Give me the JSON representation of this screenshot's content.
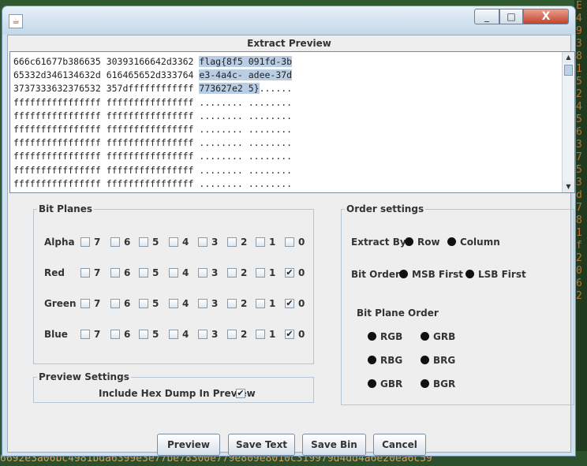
{
  "background": {
    "side_chars": [
      "E",
      "4",
      "9",
      "3",
      "8",
      "1",
      "5",
      "2",
      "4",
      "5",
      "6",
      "3",
      "7",
      "5",
      "3",
      "d",
      "7",
      "8",
      "1",
      "f",
      "2",
      "0",
      "6",
      "2"
    ],
    "bottom_text": "6692e3a06bc4981bda6399e3e77be78300e779e809e8010c319979d4dd4a6e20ea6c59"
  },
  "window": {
    "close_glyph": "X",
    "minimize_glyph": "_",
    "maximize_glyph": "□"
  },
  "preview": {
    "title": "Extract Preview",
    "lines": [
      {
        "hex": "666c61677b386635 30393166642d3362 ",
        "ascii_hl": "flag{8f5 091fd-3b",
        "ascii_rest": ""
      },
      {
        "hex": "65332d346134632d 616465652d333764 ",
        "ascii_hl": "e3-4a4c- adee-37d",
        "ascii_rest": ""
      },
      {
        "hex": "3737333632376532 357dffffffffffff ",
        "ascii_hl": "773627e2 5}",
        "ascii_rest": "......"
      },
      {
        "hex": "ffffffffffffffff ffffffffffffffff ",
        "ascii_hl": "",
        "ascii_rest": "........ ........"
      },
      {
        "hex": "ffffffffffffffff ffffffffffffffff ",
        "ascii_hl": "",
        "ascii_rest": "........ ........"
      },
      {
        "hex": "ffffffffffffffff ffffffffffffffff ",
        "ascii_hl": "",
        "ascii_rest": "........ ........"
      },
      {
        "hex": "ffffffffffffffff ffffffffffffffff ",
        "ascii_hl": "",
        "ascii_rest": "........ ........"
      },
      {
        "hex": "ffffffffffffffff ffffffffffffffff ",
        "ascii_hl": "",
        "ascii_rest": "........ ........"
      },
      {
        "hex": "ffffffffffffffff ffffffffffffffff ",
        "ascii_hl": "",
        "ascii_rest": "........ ........"
      },
      {
        "hex": "ffffffffffffffff ffffffffffffffff ",
        "ascii_hl": "",
        "ascii_rest": "........ ........"
      }
    ]
  },
  "bit_planes": {
    "title": "Bit Planes",
    "bits": [
      "7",
      "6",
      "5",
      "4",
      "3",
      "2",
      "1",
      "0"
    ],
    "rows": [
      {
        "label": "Alpha",
        "checked": [
          false,
          false,
          false,
          false,
          false,
          false,
          false,
          false
        ]
      },
      {
        "label": "Red",
        "checked": [
          false,
          false,
          false,
          false,
          false,
          false,
          false,
          true
        ]
      },
      {
        "label": "Green",
        "checked": [
          false,
          false,
          false,
          false,
          false,
          false,
          false,
          true
        ]
      },
      {
        "label": "Blue",
        "checked": [
          false,
          false,
          false,
          false,
          false,
          false,
          false,
          true
        ]
      }
    ]
  },
  "preview_settings": {
    "title": "Preview Settings",
    "hex_dump_label": "Include Hex Dump In Preview",
    "hex_dump_checked": true
  },
  "order_settings": {
    "title": "Order settings",
    "extract_by_label": "Extract By",
    "extract_by_options": [
      "Row",
      "Column"
    ],
    "bit_order_label": "Bit Order",
    "bit_order_options": [
      "MSB First",
      "LSB First"
    ],
    "bit_plane_order_label": "Bit Plane Order",
    "bit_plane_order_options": [
      "RGB",
      "GRB",
      "RBG",
      "BRG",
      "GBR",
      "BGR"
    ]
  },
  "buttons": {
    "preview": "Preview",
    "save_text": "Save Text",
    "save_bin": "Save Bin",
    "cancel": "Cancel"
  },
  "check_glyph": "✔"
}
